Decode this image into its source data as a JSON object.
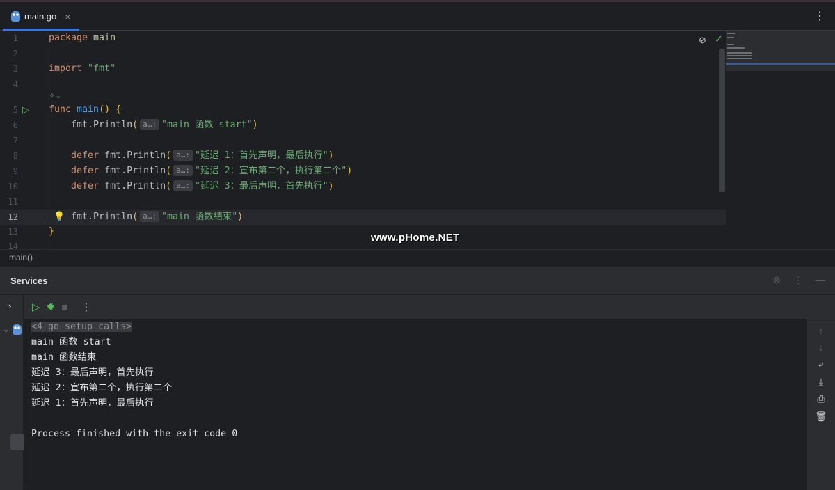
{
  "tab": {
    "label": "main.go",
    "close": "×",
    "menu": "⋮"
  },
  "editor": {
    "line_numbers": [
      "1",
      "2",
      "3",
      "4",
      "5",
      "6",
      "7",
      "8",
      "9",
      "10",
      "11",
      "12",
      "13",
      "14"
    ],
    "current_line": "12",
    "inlay_hint": "a…:",
    "ai_hint": "✧⌄",
    "lines": [
      [
        [
          "kw",
          "package "
        ],
        [
          "pkg",
          "main"
        ]
      ],
      [],
      [
        [
          "kw",
          "import "
        ],
        [
          "str",
          "\"fmt\""
        ]
      ],
      [],
      [
        [
          "kw",
          "func "
        ],
        [
          "fn",
          "main"
        ],
        [
          "br",
          "() {"
        ]
      ],
      [
        [
          "id",
          "    fmt.Println"
        ],
        [
          "br",
          "("
        ],
        [
          "hint",
          "a…:"
        ],
        [
          "str",
          "\"main 函数 start\""
        ],
        [
          "br",
          ")"
        ]
      ],
      [],
      [
        [
          "kw",
          "    defer "
        ],
        [
          "id",
          "fmt.Println"
        ],
        [
          "br",
          "("
        ],
        [
          "hint",
          "a…:"
        ],
        [
          "str",
          "\"延迟 1：首先声明，最后执行\""
        ],
        [
          "br",
          ")"
        ]
      ],
      [
        [
          "kw",
          "    defer "
        ],
        [
          "id",
          "fmt.Println"
        ],
        [
          "br",
          "("
        ],
        [
          "hint",
          "a…:"
        ],
        [
          "str",
          "\"延迟 2：宣布第二个，执行第二个\""
        ],
        [
          "br",
          ")"
        ]
      ],
      [
        [
          "kw",
          "    defer "
        ],
        [
          "id",
          "fmt.Println"
        ],
        [
          "br",
          "("
        ],
        [
          "hint",
          "a…:"
        ],
        [
          "str",
          "\"延迟 3：最后声明，首先执行\""
        ],
        [
          "br",
          ")"
        ]
      ],
      [],
      [
        [
          "id",
          "    fmt.Println"
        ],
        [
          "br",
          "("
        ],
        [
          "hint",
          "a…:"
        ],
        [
          "str",
          "\"main 函数结束\""
        ],
        [
          "br",
          ")"
        ]
      ],
      [
        [
          "br",
          "}"
        ]
      ],
      []
    ]
  },
  "watermark": "www.pHome.NET",
  "breadcrumb": "main()",
  "services": {
    "title": "Services",
    "console_lines": [
      "main 函数 start",
      "main 函数结束",
      "延迟 3：最后声明，首先执行",
      "延迟 2：宣布第二个，执行第二个",
      "延迟 1：首先声明，最后执行",
      "",
      "Process finished with the exit code 0"
    ],
    "setup_calls": "<4 go setup calls>"
  }
}
